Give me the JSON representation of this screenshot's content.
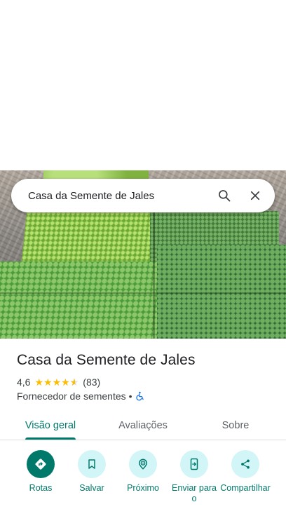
{
  "search": {
    "value": "Casa da Semente de Jales",
    "search_icon": "search-icon",
    "close_icon": "close-icon"
  },
  "hero": {
    "image": "seedling-trays-photo"
  },
  "place": {
    "name": "Casa da Semente de Jales",
    "rating": "4,6",
    "rating_value": 4.6,
    "rating_max": 5,
    "review_count": "(83)",
    "category": "Fornecedor de sementes",
    "separator": "•",
    "accessibility_icon": "wheelchair-icon"
  },
  "tabs": [
    {
      "label": "Visão geral",
      "active": true
    },
    {
      "label": "Avaliações",
      "active": false
    },
    {
      "label": "Sobre",
      "active": false
    }
  ],
  "actions": [
    {
      "label": "Rotas",
      "icon": "directions-icon"
    },
    {
      "label": "Salvar",
      "icon": "bookmark-icon"
    },
    {
      "label": "Próximo",
      "icon": "nearby-icon"
    },
    {
      "label": "Enviar para o",
      "icon": "send-to-phone-icon"
    },
    {
      "label": "Compartilhar",
      "icon": "share-icon"
    }
  ],
  "colors": {
    "accent": "#00796b",
    "action_bg": "#d2f5f7",
    "star": "#fbbc04",
    "text": "#202124",
    "secondary_text": "#3c4043",
    "accessibility": "#1a73e8"
  }
}
